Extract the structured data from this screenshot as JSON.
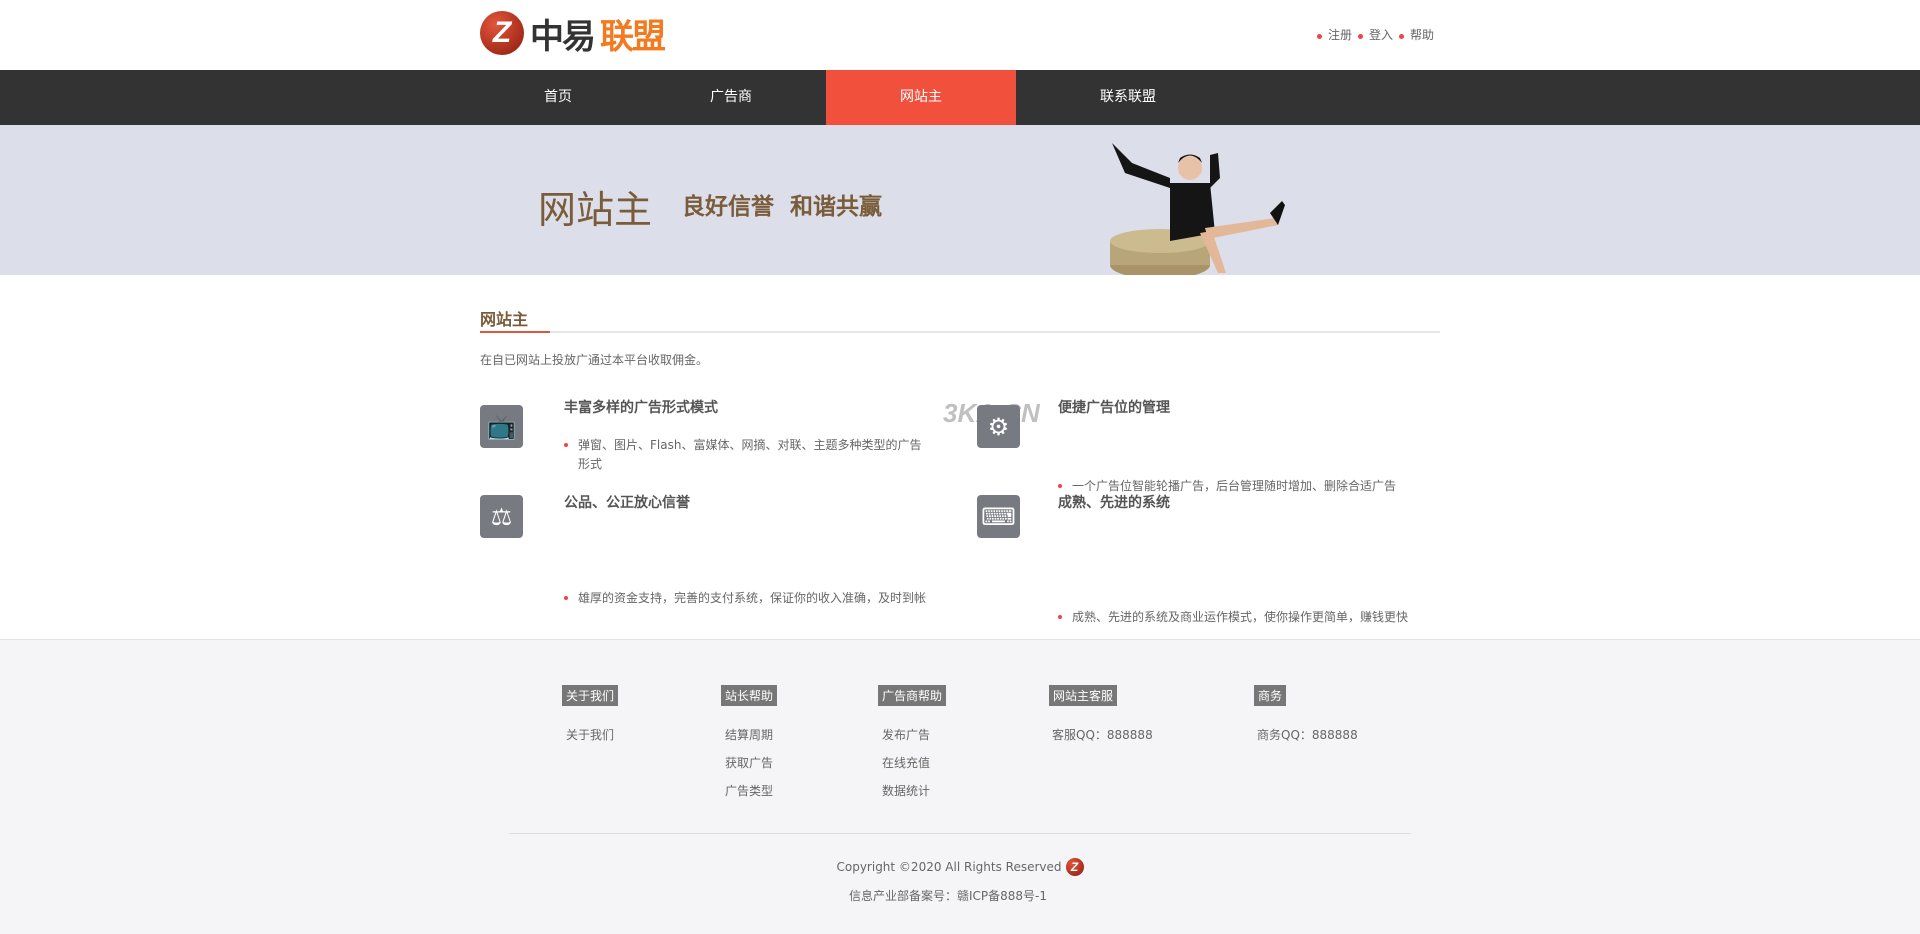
{
  "header": {
    "logo_text_dark": "中易",
    "logo_text_accent": "联盟",
    "links": [
      "注册",
      "登入",
      "帮助"
    ]
  },
  "nav": {
    "items": [
      "首页",
      "广告商",
      "网站主",
      "联系联盟"
    ],
    "active": "网站主"
  },
  "banner": {
    "title": "网站主",
    "slogan": "良好信誉 和谐共赢"
  },
  "section": {
    "title": "网站主",
    "intro": "在自已网站上投放广通过本平台收取佣金。"
  },
  "watermark": "3KA.CN",
  "features": [
    {
      "icon": "tv-icon",
      "title": "丰富多样的广告形式模式",
      "text": "弹窗、图片、Flash、富媒体、网摘、对联、主题多种类型的广告形式"
    },
    {
      "icon": "gear-icon",
      "title": "便捷广告位的管理",
      "text": "一个广告位智能轮播广告，后台管理随时增加、删除合适广告"
    },
    {
      "icon": "scale-icon",
      "title": "公品、公正放心信誉",
      "text": "雄厚的资金支持，完善的支付系统，保证你的收入准确，及时到帐"
    },
    {
      "icon": "keyboard-icon",
      "title": "成熟、先进的系统",
      "text": "成熟、先进的系统及商业运作模式，使你操作更简单，赚钱更快"
    }
  ],
  "footer": {
    "columns": [
      {
        "heading": "关于我们",
        "links": [
          "关于我们"
        ]
      },
      {
        "heading": "站长帮助",
        "links": [
          "结算周期",
          "获取广告",
          "广告类型"
        ]
      },
      {
        "heading": "广告商帮助",
        "links": [
          "发布广告",
          "在线充值",
          "数据统计"
        ]
      },
      {
        "heading": "网站主客服",
        "links": [
          "客服QQ：888888"
        ]
      },
      {
        "heading": "商务",
        "links": [
          "商务QQ：888888"
        ]
      }
    ],
    "copyright": "Copyright ©2020 All Rights Reserved",
    "icp": "信息产业部备案号：赣ICP备888号-1"
  },
  "colors": {
    "nav_bg": "#333333",
    "accent": "#f0503c",
    "banner_bg": "#dcdee9",
    "brand_brown": "#7a5c3a"
  }
}
